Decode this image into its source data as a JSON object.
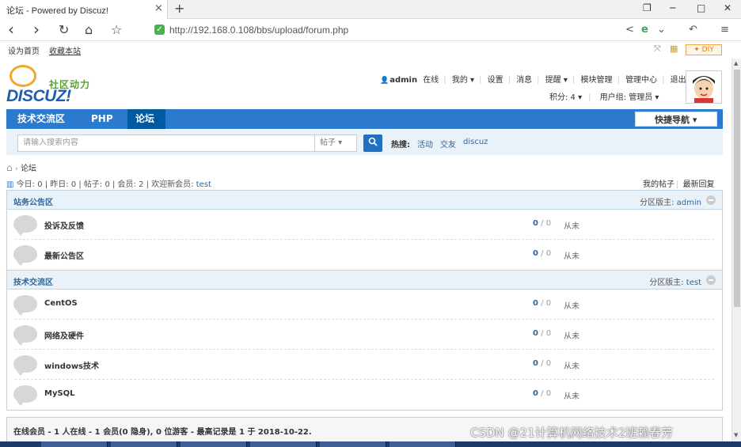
{
  "browser": {
    "tab_title": "论坛 - Powered by Discuz!",
    "tab_close": "×",
    "new_tab": "+",
    "url": "http://192.168.0.108/bbs/upload/forum.php",
    "window_controls": {
      "restore": "❐",
      "minimize": "─",
      "maximize": "□",
      "close": "✕"
    },
    "nav_icons": {
      "back": "‹",
      "forward": "›",
      "reload": "↻",
      "home": "⌂",
      "favorite": "☆"
    },
    "toolbar_icons": {
      "share": "<",
      "browser_logo": "e",
      "dropdown": "⌄",
      "undo": "↶",
      "menu": "≡"
    }
  },
  "favorites": {
    "set_home": "设为首页",
    "bookmark": "收藏本站",
    "diy": "✦ DIY",
    "icons": {
      "zoom": "⤧",
      "palette": "▦",
      "skin": "▣"
    }
  },
  "header": {
    "logo_cn": "社区动力",
    "logo_text": "DISCUZ!",
    "user_icon": "👤",
    "username": "admin",
    "user_items": [
      "在线",
      "我的 ▾",
      "设置",
      "消息",
      "提醒 ▾",
      "模块管理",
      "管理中心",
      "退出"
    ],
    "credits": "积分: 4 ▾",
    "usergroup": "用户组: 管理员 ▾",
    "avatar_face": "☺"
  },
  "nav": {
    "tabs": [
      "技术交流区",
      "PHP",
      "论坛"
    ],
    "quick_nav": "快捷导航 ▾"
  },
  "search": {
    "placeholder": "请输入搜索内容",
    "type": "帖子 ▾",
    "button_icon": "🔍",
    "hot_label": "热搜:",
    "hot_items": [
      "活动",
      "交友",
      "discuz"
    ]
  },
  "breadcrumb": {
    "home_icon": "⌂",
    "arrow": "›",
    "current": "论坛"
  },
  "stats": {
    "icon": "▥",
    "text": "今日: 0  |  昨日: 0  |  帖子: 0  |  会员: 2  |  欢迎新会员:",
    "new_member": "test",
    "my_posts": "我的帖子",
    "latest_replies": "最新回复"
  },
  "categories": [
    {
      "title": "站务公告区",
      "moderator_label": "分区版主:",
      "moderator": "admin",
      "forums": [
        {
          "name": "投诉及反馈",
          "threads": "0",
          "slash": " / ",
          "posts": "0",
          "last": "从未"
        },
        {
          "name": "最新公告区",
          "threads": "0",
          "slash": " / ",
          "posts": "0",
          "last": "从未"
        }
      ]
    },
    {
      "title": "技术交流区",
      "moderator_label": "分区版主:",
      "moderator": "test",
      "forums": [
        {
          "name": "CentOS",
          "threads": "0",
          "slash": " / ",
          "posts": "0",
          "last": "从未"
        },
        {
          "name": "网络及硬件",
          "threads": "0",
          "slash": " / ",
          "posts": "0",
          "last": "从未"
        },
        {
          "name": "windows技术",
          "threads": "0",
          "slash": " / ",
          "posts": "0",
          "last": "从未"
        },
        {
          "name": "MySQL",
          "threads": "0",
          "slash": " / ",
          "posts": "0",
          "last": "从未"
        }
      ]
    }
  ],
  "online": {
    "text": "在线会员 - 1 人在线 - 1 会员(0 隐身), 0 位游客 - 最高记录是 1 于 2018-10-22."
  },
  "watermark": "CSDN @21计算机网络技术2班赖春芳",
  "colors": {
    "nav_blue": "#2b7acd",
    "link_blue": "#336699",
    "header_bg": "#e9f1f9",
    "diy_orange": "#e07b00"
  }
}
